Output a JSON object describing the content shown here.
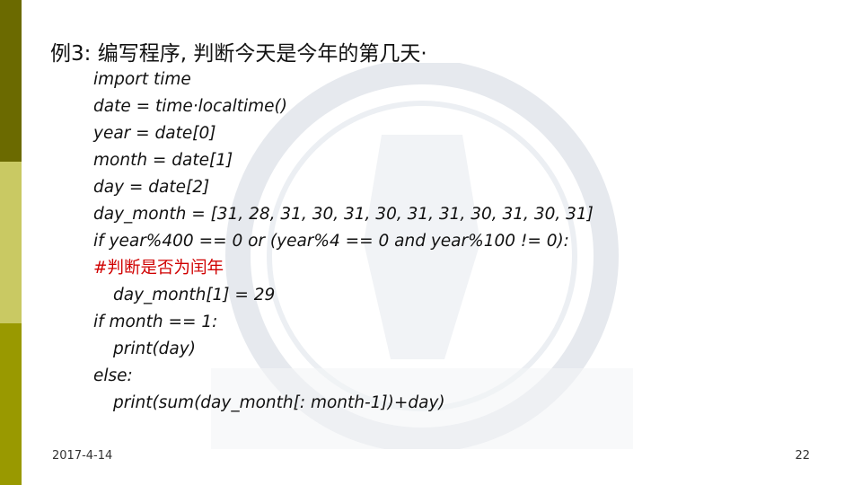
{
  "slide": {
    "title": "例3: 编写程序, 判断今天是今年的第几天·",
    "code_lines": [
      "import time",
      "date = time·localtime()",
      "year = date[0]",
      "month = date[1]",
      "day = date[2]",
      "day_month = [31, 28, 31, 30, 31, 30, 31, 31, 30, 31, 30, 31]",
      "if year%400 == 0 or (year%4 == 0 and year%100 != 0):",
      "#判断是否为闰年",
      "day_month[1] = 29",
      "if month == 1:",
      "print(day)",
      "else:",
      "print(sum(day_month[: month-1])+day)"
    ],
    "date": "2017-4-14",
    "page_number": "22"
  },
  "colors": {
    "bar_top": "#6b6a00",
    "bar_mid": "#c9c963",
    "bar_bottom": "#999900",
    "comment": "#d00000"
  }
}
